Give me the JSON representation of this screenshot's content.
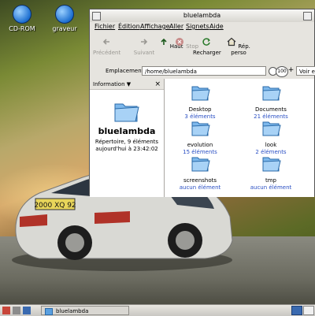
{
  "desktop": {
    "icons": [
      {
        "label": "CD-ROM",
        "icon": "cdrom-icon"
      },
      {
        "label": "graveur",
        "icon": "cd-burner-icon"
      }
    ]
  },
  "window": {
    "title": "bluelambda",
    "menu": [
      "Fichier",
      "Édition",
      "Affichage",
      "Aller",
      "Signets",
      "Aide"
    ],
    "toolbar": {
      "back": "Précédent",
      "forward": "Suivant",
      "up": "Haut",
      "stop": "Stop",
      "reload": "Recharger",
      "home": "Rép. perso"
    },
    "location": {
      "label": "Emplacement :",
      "value": "/home/bluelambda",
      "zoom": "100",
      "view_as": "Voir en tant qu'icônes"
    },
    "sidebar": {
      "header": "Information",
      "name": "bluelambda",
      "info_line1": "Répertoire, 9 éléments",
      "info_line2": "aujourd'hui à 23:42:02"
    },
    "files": [
      {
        "name": "Desktop",
        "count": "3 éléments"
      },
      {
        "name": "Documents",
        "count": "21 éléments"
      },
      {
        "name": "evolution",
        "count": "15 éléments"
      },
      {
        "name": "look",
        "count": "2 éléments"
      },
      {
        "name": "screenshots",
        "count": "aucun élément"
      },
      {
        "name": "tmp",
        "count": "aucun élément"
      }
    ]
  },
  "panel": {
    "task_label": "bluelambda"
  },
  "colors": {
    "link_blue": "#2a4fc4",
    "folder_blue": "#5aa0e0"
  }
}
